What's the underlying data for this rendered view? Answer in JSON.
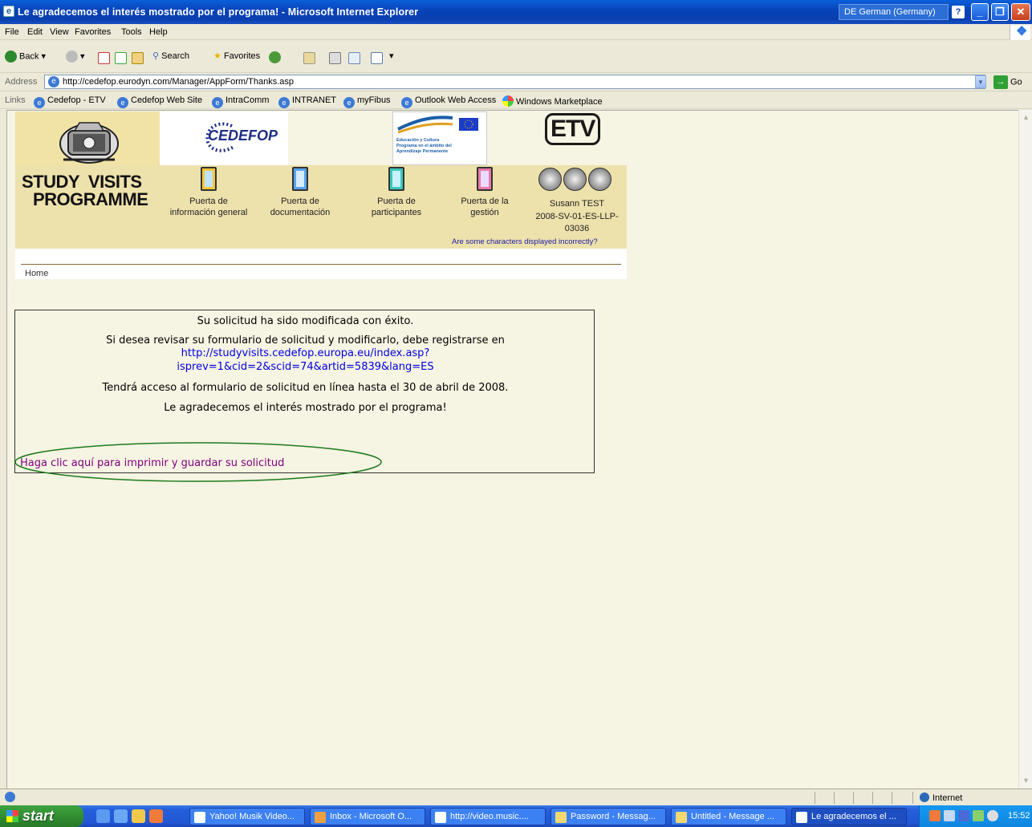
{
  "window": {
    "title": "Le agradecemos el interés mostrado por el programa! - Microsoft Internet Explorer",
    "language": "DE German (Germany)",
    "help_glyph": "?"
  },
  "menu": [
    "File",
    "Edit",
    "View",
    "Favorites",
    "Tools",
    "Help"
  ],
  "toolbar": {
    "back": "Back",
    "search": "Search",
    "favorites": "Favorites"
  },
  "address": {
    "label": "Address",
    "url": "http://cedefop.eurodyn.com/Manager/AppForm/Thanks.asp",
    "go": "Go"
  },
  "links": {
    "label": "Links",
    "items": [
      "Cedefop - ETV",
      "Cedefop Web Site",
      "IntraComm",
      "INTRANET",
      "myFibus",
      "Outlook Web Access",
      "Windows Marketplace"
    ]
  },
  "header": {
    "cedefop": "CEDEFOP",
    "eu_lines": [
      "Educación y Cultura",
      "Programa en el ámbito del",
      "Aprendizaje Permanente"
    ],
    "etv": "ETV",
    "programme_line1": "STUDY  VISITS",
    "programme_line2": "PROGRAMME",
    "doors": [
      {
        "line1": "Puerta de",
        "line2": "información general"
      },
      {
        "line1": "Puerta de",
        "line2": "documentación"
      },
      {
        "line1": "Puerta de",
        "line2": "participantes"
      },
      {
        "line1": "Puerta de la",
        "line2": "gestión"
      }
    ],
    "user_line1": "Susann TEST",
    "user_line2": "2008-SV-01-ES-LLP-",
    "user_line3": "03036",
    "charset_link": "Are some characters displayed incorrectly?",
    "breadcrumb": "Home"
  },
  "message": {
    "line1": "Su solicitud ha sido modificada con éxito.",
    "line2": "Si desea revisar su formulario de solicitud y modificarlo, debe registrarse en",
    "link1": "http://studyvisits.cedefop.europa.eu/index.asp?",
    "link2": "isprev=1&cid=2&scid=74&artid=5839&lang=ES",
    "line3": "Tendrá acceso al formulario de solicitud en línea hasta el 30 de abril de 2008.",
    "line4": "Le agradecemos el interés mostrado por el programa!",
    "print_link": "Haga clic aquí para imprimir y guardar su solicitud"
  },
  "status": {
    "zone": "Internet"
  },
  "taskbar": {
    "start": "start",
    "tasks": [
      "Yahoo! Musik Video...",
      "Inbox - Microsoft O...",
      "http://video.music....",
      "Password - Messag...",
      "Untitled - Message ...",
      "Le agradecemos el ..."
    ],
    "clock": "15:52"
  },
  "colors": {
    "link": "#0000e6",
    "visited": "#800080",
    "ellipse": "#1d7a1d",
    "header_band": "#ede1ac"
  }
}
